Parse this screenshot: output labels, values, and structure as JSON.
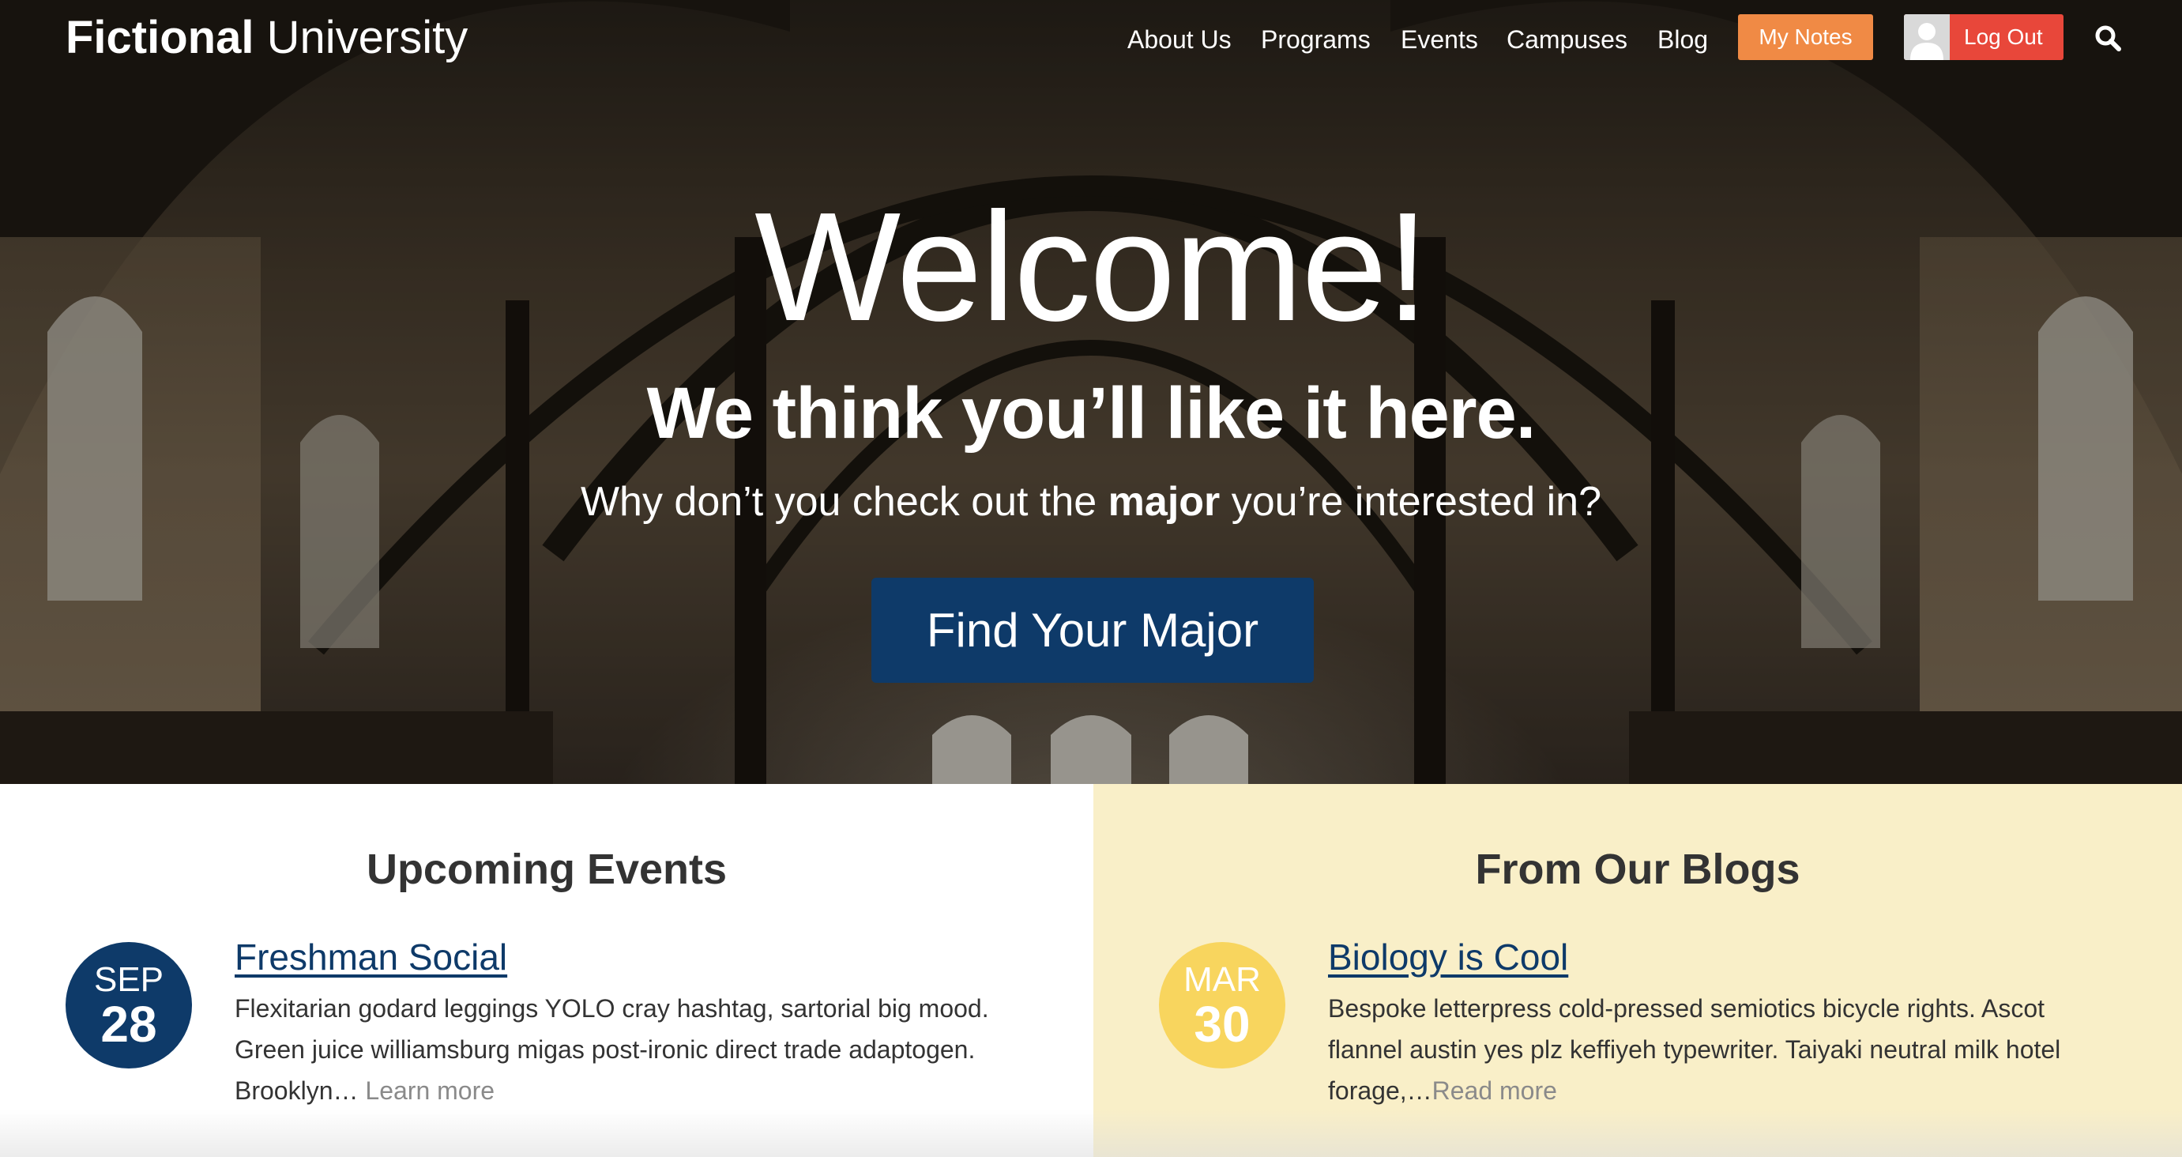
{
  "header": {
    "logo_bold": "Fictional",
    "logo_light": "University",
    "nav": [
      "About Us",
      "Programs",
      "Events",
      "Campuses",
      "Blog"
    ],
    "my_notes_label": "My Notes",
    "logout_label": "Log Out"
  },
  "hero": {
    "title": "Welcome!",
    "subtitle": "We think you’ll like it here.",
    "lead_before": "Why don’t you check out the ",
    "lead_bold": "major",
    "lead_after": " you’re interested in?",
    "cta_label": "Find Your Major"
  },
  "events": {
    "title": "Upcoming Events",
    "item": {
      "month": "SEP",
      "day": "28",
      "title": "Freshman Social",
      "excerpt": "Flexitarian godard leggings YOLO cray hashtag, sartorial big mood. Green juice williamsburg migas post-ironic direct trade adaptogen. Brooklyn… ",
      "link": "Learn more"
    }
  },
  "blogs": {
    "title": "From Our Blogs",
    "item": {
      "month": "MAR",
      "day": "30",
      "title": "Biology is Cool",
      "excerpt": "Bespoke letterpress cold-pressed semiotics bicycle rights. Ascot flannel austin yes plz keffiyeh typewriter. Taiyaki neutral milk hotel forage,…",
      "link": "Read more"
    }
  },
  "colors": {
    "brand_blue": "#0e3a69",
    "notes_orange": "#f08a45",
    "logout_red": "#e8473a",
    "blog_panel_bg": "#f9efc8",
    "blog_date_yellow": "#f8d55e"
  }
}
